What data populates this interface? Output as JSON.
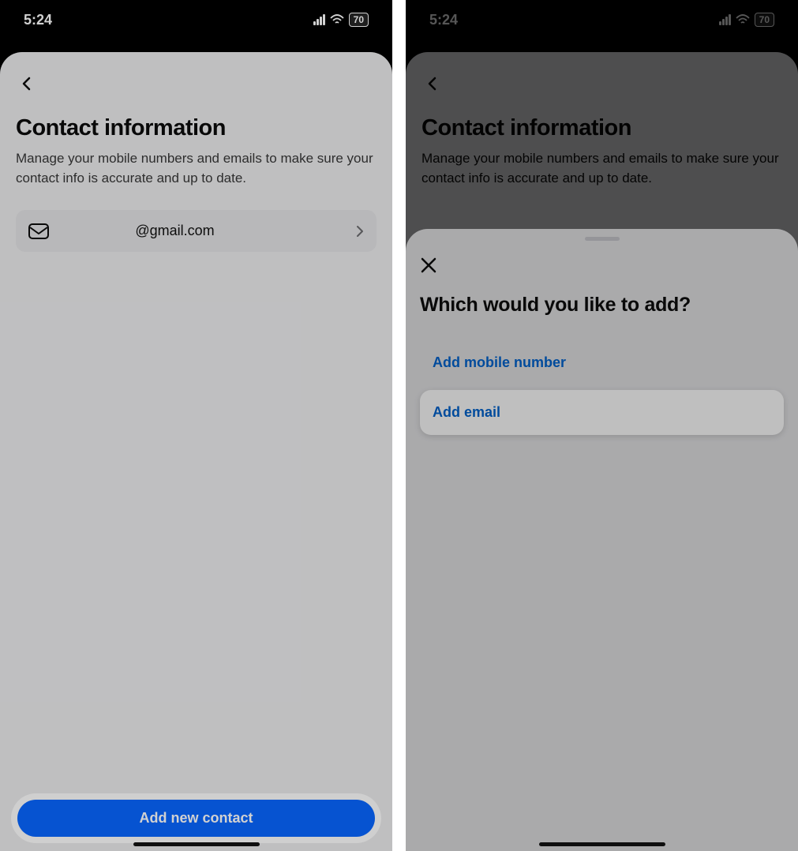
{
  "status": {
    "time": "5:24",
    "battery": "70"
  },
  "screen1": {
    "title": "Contact information",
    "subtitle": "Manage your mobile numbers and emails to make sure your contact info is accurate and up to date.",
    "email_row": "@gmail.com",
    "add_button": "Add new contact"
  },
  "screen2": {
    "title": "Contact information",
    "subtitle": "Manage your mobile numbers and emails to make sure your contact info is accurate and up to date.",
    "modal": {
      "title": "Which would you like to add?",
      "options": {
        "mobile": "Add mobile number",
        "email": "Add email"
      }
    }
  }
}
